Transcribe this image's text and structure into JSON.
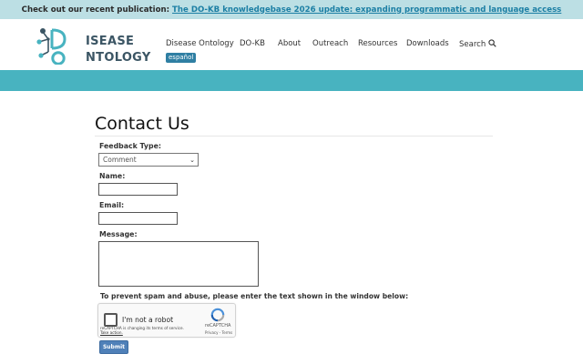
{
  "announcement": {
    "lead": "Check out our recent publication:",
    "link": "The DO-KB knowledgebase 2026 update: expanding programmatic and language access"
  },
  "logo": {
    "line1": "ISEASE",
    "line2": "NTOLOGY",
    "initial1": "D",
    "initial2": "O"
  },
  "nav": {
    "items": [
      "Disease Ontology",
      "DO-KB",
      "About",
      "Outreach",
      "Resources",
      "Downloads",
      "Search"
    ],
    "language_badge": "español"
  },
  "colors": {
    "announcement_bg": "#bcdfe4",
    "band": "#48b3c0",
    "link": "#1c7fa4",
    "badge": "#2f7fa3",
    "submit": "#4f80b8"
  },
  "form": {
    "title": "Contact Us",
    "feedback_type_label": "Feedback Type:",
    "feedback_type_value": "Comment",
    "name_label": "Name:",
    "email_label": "Email:",
    "message_label": "Message:",
    "spam_notice": "To prevent spam and abuse, please enter the text shown in the window below:",
    "submit_label": "Submit"
  },
  "captcha": {
    "checkbox_label": "I'm not a robot",
    "terms_line1": "reCAPTCHA is changing its terms of service.",
    "terms_line2": "Take action.",
    "brand": "reCAPTCHA",
    "links": "Privacy - Terms"
  }
}
